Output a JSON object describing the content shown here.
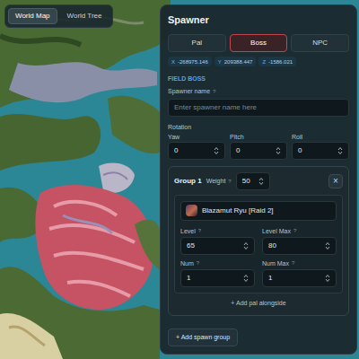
{
  "map_tabs": [
    {
      "label": "World Map",
      "selected": true
    },
    {
      "label": "World Tree",
      "selected": false
    }
  ],
  "spawner": {
    "title": "Spawner",
    "tabs": [
      {
        "label": "Pal",
        "selected": false
      },
      {
        "label": "Boss",
        "selected": true
      },
      {
        "label": "NPC",
        "selected": false
      }
    ],
    "coords": [
      {
        "axis": "X",
        "value": "-268975.146"
      },
      {
        "axis": "Y",
        "value": "209388.447"
      },
      {
        "axis": "Z",
        "value": "-1586.021"
      }
    ],
    "section": "FIELD BOSS",
    "name_field": {
      "label": "Spawner name",
      "help": "?",
      "placeholder": "Enter spawner name here"
    },
    "rotation": {
      "label": "Rotation",
      "fields": [
        {
          "label": "Yaw",
          "value": "0"
        },
        {
          "label": "Pitch",
          "value": "0"
        },
        {
          "label": "Roll",
          "value": "0"
        }
      ]
    },
    "groups": [
      {
        "title": "Group 1",
        "weight_label": "Weight",
        "weight_help": "?",
        "weight": "50",
        "close": "×",
        "pal": "Blazamut Ryu [Raid 2]",
        "fields": [
          {
            "label": "Level",
            "help": "?",
            "value": "65"
          },
          {
            "label": "Level Max",
            "help": "?",
            "value": "80"
          },
          {
            "label": "Num",
            "help": "?",
            "value": "1"
          },
          {
            "label": "Num Max",
            "help": "?",
            "value": "1"
          }
        ],
        "add_pal": "+ Add pal alongside"
      }
    ],
    "add_group": "+ Add spawn group"
  }
}
